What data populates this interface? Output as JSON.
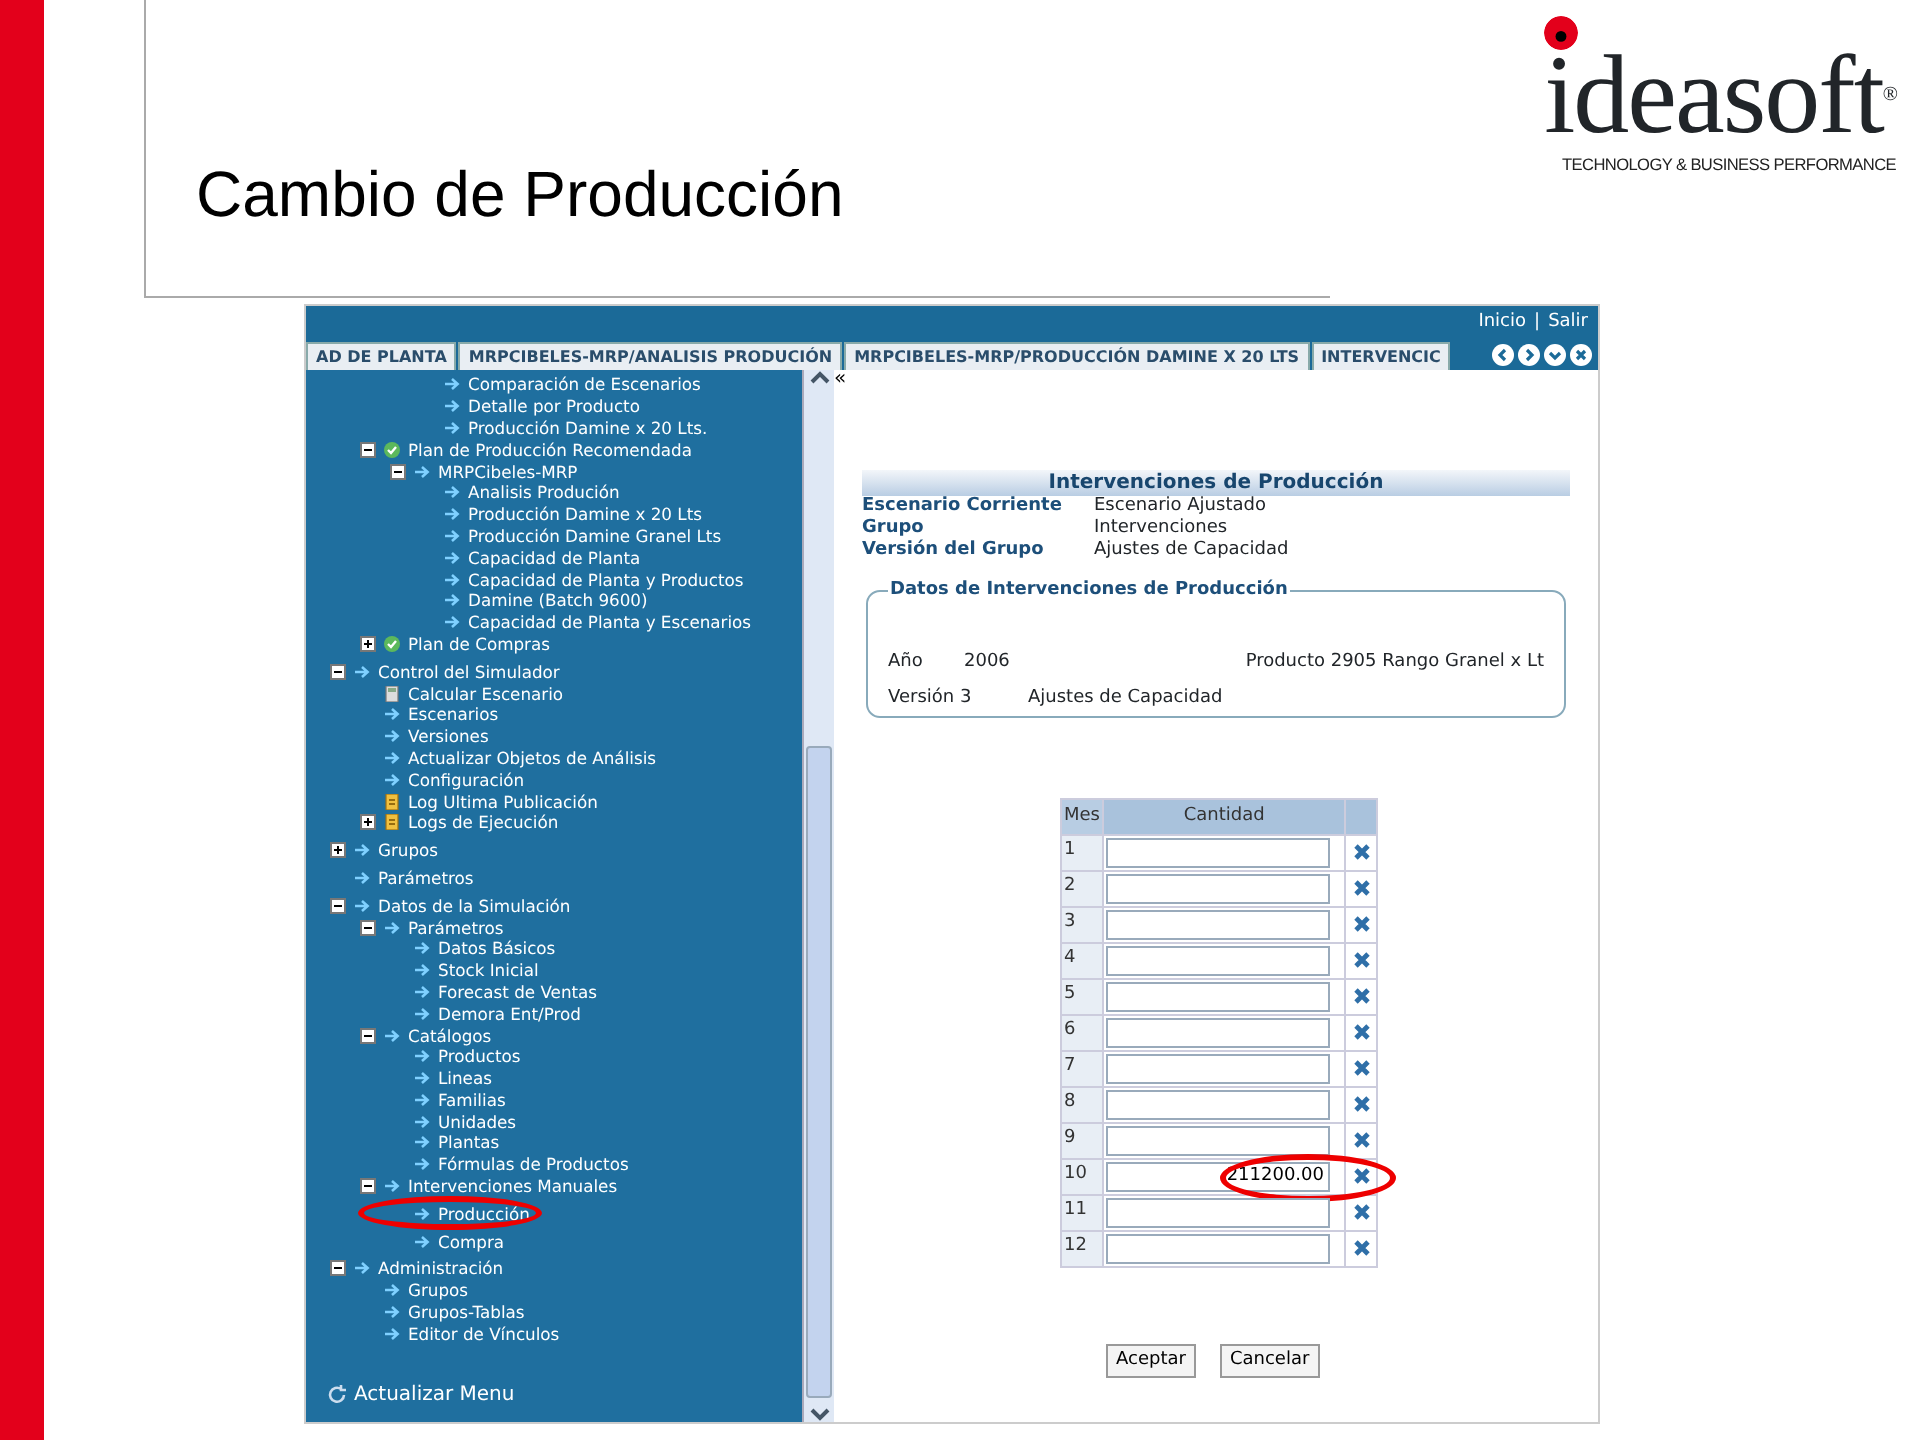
{
  "slide": {
    "title": "Cambio de Producción",
    "logo": {
      "name": "ideasoft",
      "mark": "®",
      "tagline": "TECHNOLOGY & BUSINESS PERFORMANCE"
    }
  },
  "app": {
    "top_links": [
      "Inicio",
      "|",
      "Salir"
    ],
    "tabs": [
      {
        "label": "AD DE PLANTA"
      },
      {
        "label": "MRPCIBELES-MRP/ANALISIS PRODUCIÓN"
      },
      {
        "label": "MRPCIBELES-MRP/PRODUCCIÓN DAMINE X 20 LTS"
      },
      {
        "label": "INTERVENCIC"
      }
    ],
    "tab_buttons": [
      {
        "kind": "prev"
      },
      {
        "kind": "next"
      },
      {
        "kind": "down"
      },
      {
        "kind": "close"
      }
    ],
    "collapse_button": "«",
    "sidebar": {
      "tree": [
        {
          "children": [
            {
              "children": [
                {
                  "children": [
                    {
                      "label": "Comparación de Escenarios",
                      "kind": "arrow"
                    },
                    {
                      "label": "Detalle por Producto",
                      "kind": "arrow"
                    },
                    {
                      "label": "Producción Damine x 20 Lts.",
                      "kind": "arrow"
                    }
                  ]
                }
              ]
            },
            {
              "label": "Plan de Producción Recomendada",
              "kind": "check",
              "expanded": true,
              "children": [
                {
                  "label": "MRPCibeles-MRP",
                  "kind": "arrow",
                  "expanded": true,
                  "children": [
                    {
                      "label": "Analisis Produción",
                      "kind": "arrow"
                    },
                    {
                      "label": "Producción Damine x 20 Lts",
                      "kind": "arrow"
                    },
                    {
                      "label": "Producción Damine Granel Lts",
                      "kind": "arrow"
                    },
                    {
                      "label": "Capacidad de Planta",
                      "kind": "arrow"
                    },
                    {
                      "label": "Capacidad de Planta y Productos",
                      "kind": "arrow"
                    },
                    {
                      "label": "Damine (Batch 9600)",
                      "kind": "arrow"
                    },
                    {
                      "label": "Capacidad de Planta y Escenarios",
                      "kind": "arrow"
                    }
                  ]
                }
              ]
            },
            {
              "label": "Plan de Compras",
              "kind": "check",
              "expanded": false
            }
          ]
        },
        {
          "label": "Control del Simulador",
          "kind": "arrow",
          "expanded": true,
          "children": [
            {
              "label": "Calcular Escenario",
              "kind": "calc"
            },
            {
              "label": "Escenarios",
              "kind": "arrow"
            },
            {
              "label": "Versiones",
              "kind": "arrow"
            },
            {
              "label": "Actualizar Objetos de Análisis",
              "kind": "arrow"
            },
            {
              "label": "Configuración",
              "kind": "arrow"
            },
            {
              "label": "Log Ultima Publicación",
              "kind": "log"
            },
            {
              "label": "Logs de Ejecución",
              "kind": "log",
              "expanded": false
            }
          ]
        },
        {
          "label": "Grupos",
          "kind": "arrow",
          "expanded": false
        },
        {
          "label": "Parámetros",
          "kind": "arrow"
        },
        {
          "label": "Datos de la Simulación",
          "kind": "arrow",
          "expanded": true,
          "children": [
            {
              "label": "Parámetros",
              "kind": "arrow",
              "expanded": true,
              "children": [
                {
                  "label": "Datos Básicos",
                  "kind": "arrow"
                },
                {
                  "label": "Stock Inicial",
                  "kind": "arrow"
                },
                {
                  "label": "Forecast de Ventas",
                  "kind": "arrow"
                },
                {
                  "label": "Demora Ent/Prod",
                  "kind": "arrow"
                }
              ]
            },
            {
              "label": "Catálogos",
              "kind": "arrow",
              "expanded": true,
              "children": [
                {
                  "label": "Productos",
                  "kind": "arrow"
                },
                {
                  "label": "Lineas",
                  "kind": "arrow"
                },
                {
                  "label": "Familias",
                  "kind": "arrow"
                },
                {
                  "label": "Unidades",
                  "kind": "arrow"
                },
                {
                  "label": "Plantas",
                  "kind": "arrow"
                },
                {
                  "label": "Fórmulas de Productos",
                  "kind": "arrow"
                }
              ]
            },
            {
              "label": "Intervenciones Manuales",
              "kind": "arrow",
              "expanded": true,
              "children": [
                {
                  "label": "Producción",
                  "kind": "arrow",
                  "circled": true
                },
                {
                  "label": "Compra",
                  "kind": "arrow"
                }
              ]
            }
          ]
        },
        {
          "label": "Administración",
          "kind": "arrow",
          "expanded": true,
          "children": [
            {
              "label": "Grupos",
              "kind": "arrow"
            },
            {
              "label": "Grupos-Tablas",
              "kind": "arrow"
            },
            {
              "label": "Editor de Vínculos",
              "kind": "arrow"
            }
          ]
        }
      ],
      "refresh": "Actualizar Menu"
    },
    "form": {
      "title": "Intervenciones de Producción",
      "info": [
        {
          "label": "Escenario Corriente",
          "value": "Escenario Ajustado"
        },
        {
          "label": "Grupo",
          "value": "Intervenciones"
        },
        {
          "label": "Versión del Grupo",
          "value": "Ajustes de Capacidad"
        }
      ],
      "fieldset": {
        "legend": "Datos de Intervenciones de Producción",
        "year_label": "Año",
        "year": "2006",
        "product": "Producto 2905 Rango Granel x Lt",
        "version_label": "Versión 3",
        "version": "Ajustes de Capacidad"
      },
      "grid": {
        "columns": [
          "Mes",
          "Cantidad"
        ],
        "rows": [
          {
            "month": "1"
          },
          {
            "month": "2"
          },
          {
            "month": "3"
          },
          {
            "month": "4"
          },
          {
            "month": "5"
          },
          {
            "month": "6"
          },
          {
            "month": "7"
          },
          {
            "month": "8"
          },
          {
            "month": "9"
          },
          {
            "month": "10",
            "value": "211200.00",
            "circled": true
          },
          {
            "month": "11"
          },
          {
            "month": "12"
          }
        ]
      },
      "buttons": [
        "Aceptar",
        "Cancelar"
      ]
    }
  }
}
